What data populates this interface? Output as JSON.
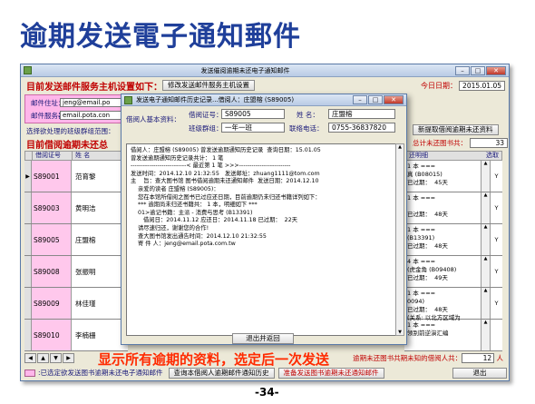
{
  "slide_title": "逾期发送電子通知郵件",
  "main_window": {
    "title": "发送催阅逾期未还电子通知邮件",
    "minimize_glyph": "–",
    "maximize_glyph": "□",
    "close_glyph": "✕"
  },
  "header": {
    "label": "目前发送邮件服务主机设置如下：",
    "button": "修改发送邮件服务主机设置",
    "date_label": "今日日期：",
    "date_value": "2015.01.05"
  },
  "mail_config": {
    "address_label": "邮件住址：",
    "address_value": "jeng@email.po",
    "server_label": "邮件服务器：",
    "server_value": "email.pota.con"
  },
  "select_label": "选择欲处理的班级群组范围：",
  "list_title": "目前借阅逾期未还总",
  "fetch_button": "新提取借阅逾期未还资料",
  "total": {
    "label": "总计未还图书共：",
    "value": "33",
    "unit": "本"
  },
  "left_grid": {
    "headers": [
      "借阅证号",
      "姓 名"
    ],
    "rows": [
      {
        "marker": "▶",
        "id": "S89001",
        "name": "范育黎"
      },
      {
        "marker": "",
        "id": "S89003",
        "name": "黄明洁"
      },
      {
        "marker": "",
        "id": "S89005",
        "name": "庄盟榕"
      },
      {
        "marker": "",
        "id": "S89008",
        "name": "张振明"
      },
      {
        "marker": "",
        "id": "S89009",
        "name": "林佳瑾"
      },
      {
        "marker": "",
        "id": "S89010",
        "name": "李楠栅"
      }
    ]
  },
  "right_grid": {
    "header": "还明细",
    "header2": "选取",
    "rows": [
      {
        "text": "1 本 ===\n真 (B08015)\n已过期：  45天",
        "flag": "Y"
      },
      {
        "text": "1 本 ===\n\n已过期：  48天",
        "flag": "Y"
      },
      {
        "text": "1 本 ===\n(B13391)\n已过期：  48天",
        "flag": "Y"
      },
      {
        "text": "4 本 ===\n(虎金角 (B09408)\n已过期：  49天",
        "flag": "Y"
      },
      {
        "text": "1 本 ===\n0094)\n已过期：  48天\n(关系: 以北方区域为",
        "flag": "Y"
      },
      {
        "text": "1 本 ===\n领别前逆演汇编",
        "flag": ""
      }
    ]
  },
  "footer": {
    "late_count_label": "逾期未还图书共",
    "late_count_suffix": "期未知的借阅人共：",
    "late_count_value": "12",
    "late_count_unit": "人",
    "nav_buttons": [
      "◀",
      "▲",
      "▼",
      "▶"
    ],
    "legend_text": ":已选定欲发送图书逾期未还电子通知邮件",
    "history_button": "查询本借阅人逾期邮件通知历史",
    "prepare_button": "准备发送图书逾期未还通知邮件",
    "exit_button": "退出"
  },
  "dialog": {
    "title": "发送电子通知邮件历史记录...借阅人：庄盟榕 (S89005)",
    "basic_info_label": "借阅人基本资料：",
    "card_label": "借阅证号：",
    "card_value": "S89005",
    "name_label": "姓    名：",
    "name_value": "庄盟榕",
    "class_label": "班级群组：",
    "class_value": "一年一班",
    "phone_label": "联络电话：",
    "phone_value": "0755-36837820",
    "lines": [
      "借阅人：庄盟榕 (S89005) 曾发送逾期通知历史记录  查询日期：15.01.05",
      "曾发送逾期通知历史记录共计： 1 笔",
      "",
      "---------------------------< 最近第 1 笔 >>>-------------------------",
      "",
      "发送时间：2014.12.10 21:32:55   发送邮址：zhuang1111@tom.com",
      "主    旨：查大图书馆 图书借阅逾期未还通知邮件  发送日期：2014.12.10",
      "",
      "    亲爱的读者 庄盟榕 (S89005)：",
      "",
      "    您在本馆所借阅之图书已过应还日期，目前逾期仍未归还书籍详列如下：",
      "",
      "    *** 逾期尚未归还书籍共： 1 本，明细如下 ***",
      "",
      "    01>逾记书籍：主派 - 消费与思考 (B13391)",
      "       借阅日：2014.11.12 应还日：2014.11.18 已过期：  22天",
      "",
      "",
      "",
      "    请尽速归还，谢谢您的合作!",
      "",
      "",
      "    查大图书馆发出通告时间：2014.12.10 21:32:55",
      "",
      "    寄 件 人：jeng@email.pota.com.tw"
    ],
    "back_button": "退出并返回"
  },
  "annotation": "显示所有逾期的资料，选定后一次发送",
  "page_number": "-34-",
  "colors": {
    "title_blue": "#1f3f9a",
    "pink": "#ffb6ea",
    "red": "#c00000",
    "annotation": "#ff2a00"
  },
  "icons": [
    "app-icon",
    "minimize-icon",
    "maximize-icon",
    "close-icon",
    "row-pointer-icon",
    "scroll-up-icon",
    "scroll-down-icon"
  ]
}
